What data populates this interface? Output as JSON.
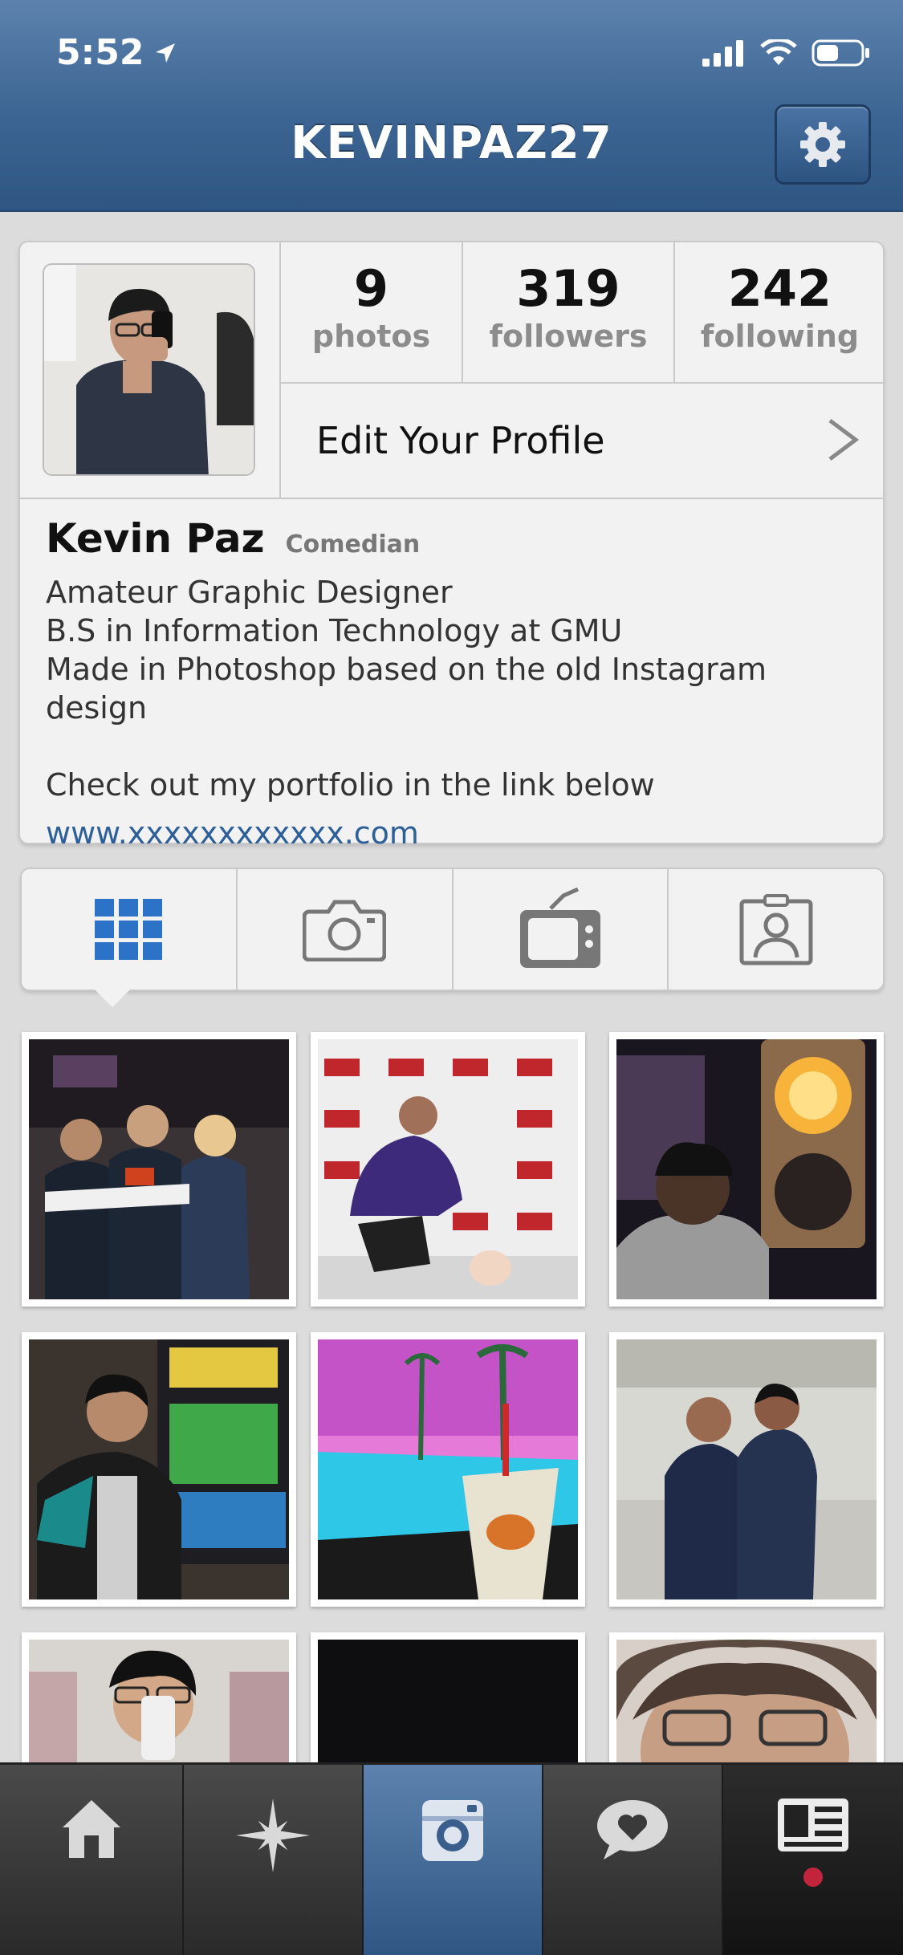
{
  "status_bar": {
    "time": "5:52"
  },
  "header": {
    "title": "KEVINPAZ27"
  },
  "profile": {
    "stats": [
      {
        "value": "9",
        "label": "photos"
      },
      {
        "value": "319",
        "label": "followers"
      },
      {
        "value": "242",
        "label": "following"
      }
    ],
    "edit_label": "Edit Your Profile",
    "name": "Kevin Paz",
    "category": "Comedian",
    "bio_lines": [
      "Amateur Graphic Designer",
      "B.S in Information Technology at GMU",
      "Made in Photoshop based on the old Instagram design",
      "",
      "Check out my portfolio in the link below"
    ],
    "link": "www.xxxxxxxxxxxx.com"
  },
  "tabs": [
    "grid-view",
    "camera",
    "tv",
    "tagged"
  ],
  "colors": {
    "header_blue": "#3d6593",
    "tab_active_blue": "#2c73c8",
    "link_blue": "#2d5f99",
    "notification_red": "#c2243b"
  }
}
